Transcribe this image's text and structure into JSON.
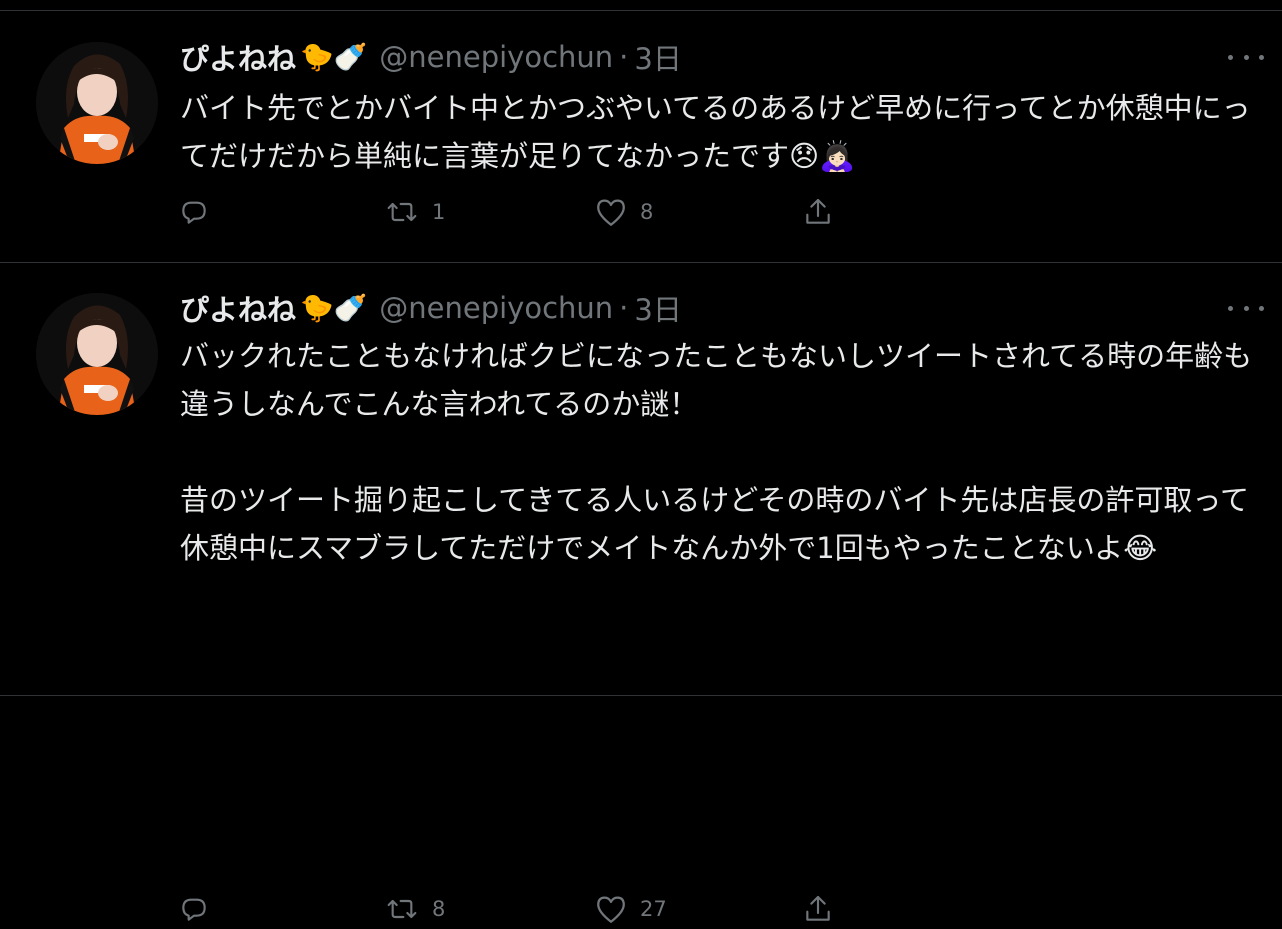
{
  "colors": {
    "background": "#000000",
    "text": "#e7e9ea",
    "muted": "#71767b",
    "divider": "#2f3336"
  },
  "tweets": [
    {
      "display_name": "ぴよねね",
      "name_emojis": "🐤🍼",
      "handle": "@nenepiyochun",
      "separator": "·",
      "time": "3日",
      "text": "バイト先でとかバイト中とかつぶやいてるのあるけど早めに行ってとか休憩中にってだけだから単純に言葉が足りてなかったです😞🙇🏻‍♀️",
      "reply_count": "",
      "retweet_count": "1",
      "like_count": "8",
      "icons": [
        "reply-icon",
        "retweet-icon",
        "like-icon",
        "share-icon",
        "more-icon"
      ]
    },
    {
      "display_name": "ぴよねね",
      "name_emojis": "🐤🍼",
      "handle": "@nenepiyochun",
      "separator": "·",
      "time": "3日",
      "text": "バックれたこともなければクビになったこともないしツイートされてる時の年齢も違うしなんでこんな言われてるのか謎！\n\n昔のツイート掘り起こしてきてる人いるけどその時のバイト先は店長の許可取って休憩中にスマブラしてただけでメイトなんか外で1回もやったことないよ😂",
      "reply_count": "",
      "retweet_count": "8",
      "like_count": "27",
      "icons": [
        "reply-icon",
        "retweet-icon",
        "like-icon",
        "share-icon",
        "more-icon"
      ]
    }
  ]
}
